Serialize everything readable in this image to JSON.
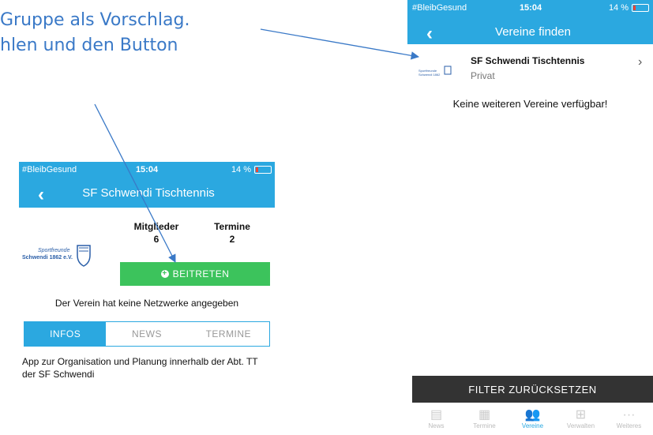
{
  "annotation": {
    "line1": "Gruppe als Vorschlag.",
    "line2": "hlen und den Button"
  },
  "right_screen": {
    "status": {
      "carrier": "#BleibGesund",
      "time": "15:04",
      "battery": "14 %"
    },
    "title": "Vereine finden",
    "club": {
      "name": "SF Schwendi Tischtennis",
      "type": "Privat"
    },
    "empty_message": "Keine weiteren Vereine verfügbar!",
    "filter_button": "FILTER ZURÜCKSETZEN",
    "tabs": [
      {
        "label": "News",
        "icon": "news-icon"
      },
      {
        "label": "Termine",
        "icon": "calendar-icon"
      },
      {
        "label": "Vereine",
        "icon": "group-icon",
        "active": true
      },
      {
        "label": "Verwalten",
        "icon": "hierarchy-icon"
      },
      {
        "label": "Weiteres",
        "icon": "more-icon"
      }
    ]
  },
  "left_screen": {
    "status": {
      "carrier": "#BleibGesund",
      "time": "15:04",
      "battery": "14 %"
    },
    "title": "SF Schwendi Tischtennis",
    "logo_text": "Sportfreunde Schwendi 1862 e.V.",
    "stats": {
      "members_label": "Mitglieder",
      "members_value": "6",
      "events_label": "Termine",
      "events_value": "2"
    },
    "join_button": "BEITRETEN",
    "no_networks": "Der Verein hat keine Netzwerke angegeben",
    "segments": [
      {
        "label": "INFOS",
        "active": true
      },
      {
        "label": "NEWS"
      },
      {
        "label": "TERMINE"
      }
    ],
    "description": "App zur Organisation und Planung innerhalb der Abt. TT der SF Schwendi"
  },
  "colors": {
    "primary": "#2ba8e0",
    "join": "#3cc35c",
    "dark": "#333333",
    "annotation": "#3a79c7"
  }
}
